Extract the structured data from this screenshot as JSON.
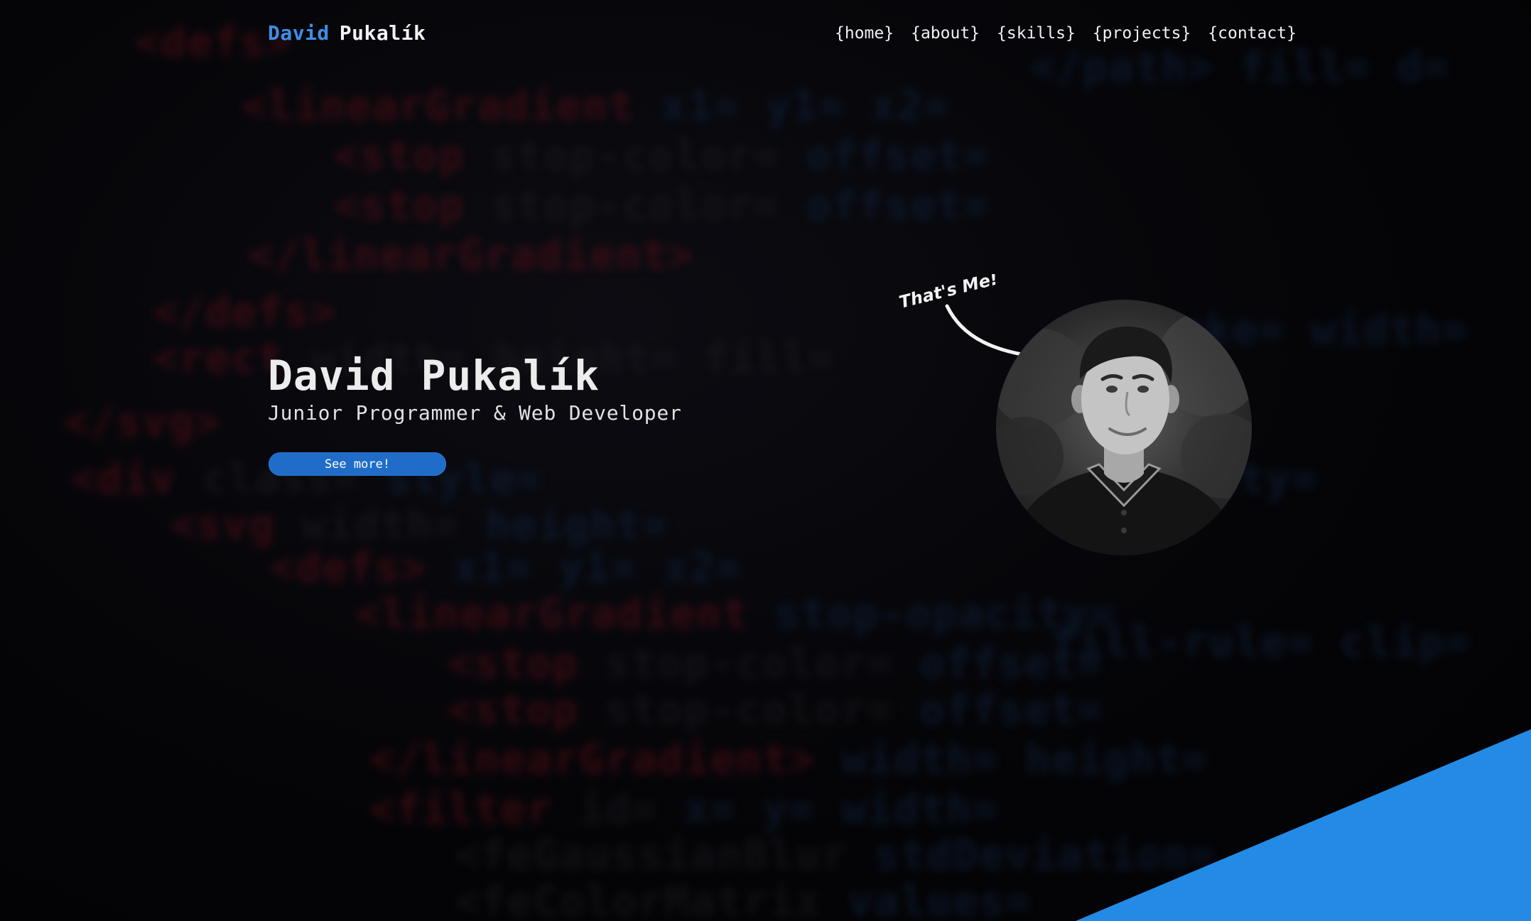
{
  "brand": {
    "first_name": "David",
    "last_name": "Pukalík"
  },
  "nav": {
    "items": [
      {
        "label": "{home}"
      },
      {
        "label": "{about}"
      },
      {
        "label": "{skills}"
      },
      {
        "label": "{projects}"
      },
      {
        "label": "{contact}"
      }
    ]
  },
  "hero": {
    "title": "David Pukalík",
    "subtitle": "Junior Programmer & Web Developer",
    "button_label": "See more!"
  },
  "portrait": {
    "annotation": "That's Me!"
  },
  "colors": {
    "accent": "#238be6",
    "button": "#1f6dc8",
    "background": "#030305",
    "text": "#ececec"
  }
}
